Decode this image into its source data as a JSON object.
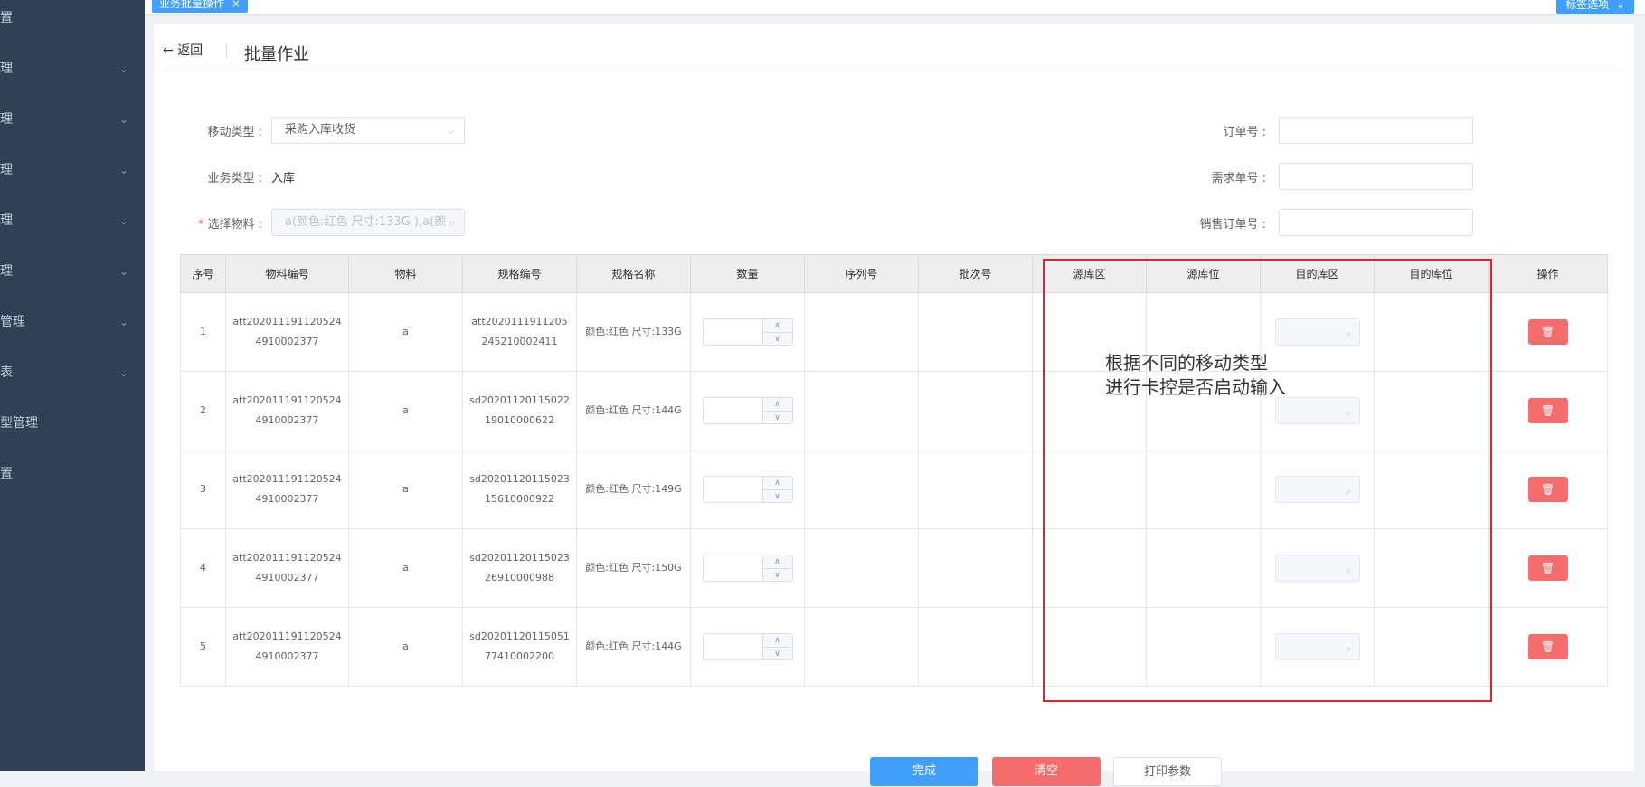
{
  "sidebar": {
    "items": [
      {
        "label": "置",
        "arrow": false
      },
      {
        "label": "理",
        "arrow": true
      },
      {
        "label": "理",
        "arrow": true
      },
      {
        "label": "理",
        "arrow": true
      },
      {
        "label": "理",
        "arrow": true
      },
      {
        "label": "理",
        "arrow": true
      },
      {
        "label": "管理",
        "arrow": true
      },
      {
        "label": "表",
        "arrow": true
      },
      {
        "label": "型管理",
        "arrow": false
      },
      {
        "label": "置",
        "arrow": false
      }
    ]
  },
  "tabs": {
    "active_label": "业务批量操作",
    "close_icon": "×",
    "right_button": "标签选项"
  },
  "header": {
    "back_label": "返回",
    "title": "批量作业"
  },
  "form": {
    "move_type_label": "移动类型 :",
    "move_type_value": "采购入库收货",
    "business_type_label": "业务类型 :",
    "business_type_value": "入库",
    "select_material_label": "选择物料 :",
    "select_material_value": "a(颜色:红色 尺寸:133G ),a(颜",
    "order_no_label": "订单号 :",
    "demand_no_label": "需求单号 :",
    "sales_order_no_label": "销售订单号 :"
  },
  "table": {
    "headers": [
      "序号",
      "物料编号",
      "物料",
      "规格编号",
      "规格名称",
      "数量",
      "序列号",
      "批次号",
      "源库区",
      "源库位",
      "目的库区",
      "目的库位",
      "操作"
    ],
    "rows": [
      {
        "index": "1",
        "material_code": "att2020111911205244910002377",
        "material": "a",
        "spec_code": "att2020111911205245210002411",
        "spec_name": "颜色:红色 尺寸:133G"
      },
      {
        "index": "2",
        "material_code": "att2020111911205244910002377",
        "material": "a",
        "spec_code": "sd2020112011502219010000622",
        "spec_name": "颜色:红色 尺寸:144G"
      },
      {
        "index": "3",
        "material_code": "att2020111911205244910002377",
        "material": "a",
        "spec_code": "sd2020112011502315610000922",
        "spec_name": "颜色:红色 尺寸:149G"
      },
      {
        "index": "4",
        "material_code": "att2020111911205244910002377",
        "material": "a",
        "spec_code": "sd2020112011502326910000988",
        "spec_name": "颜色:红色 尺寸:150G"
      },
      {
        "index": "5",
        "material_code": "att2020111911205244910002377",
        "material": "a",
        "spec_code": "sd2020112011505177410002200",
        "spec_name": "颜色:红色 尺寸:144G"
      }
    ]
  },
  "annotation": {
    "line1": "根据不同的移动类型",
    "line2": "进行卡控是否启动输入",
    "color": "#e8202a"
  },
  "buttons": {
    "finish": "完成",
    "clear": "清空",
    "print_params": "打印参数"
  },
  "colors": {
    "sidebar_bg": "#304156",
    "primary": "#409eff",
    "danger": "#f56c6c"
  }
}
